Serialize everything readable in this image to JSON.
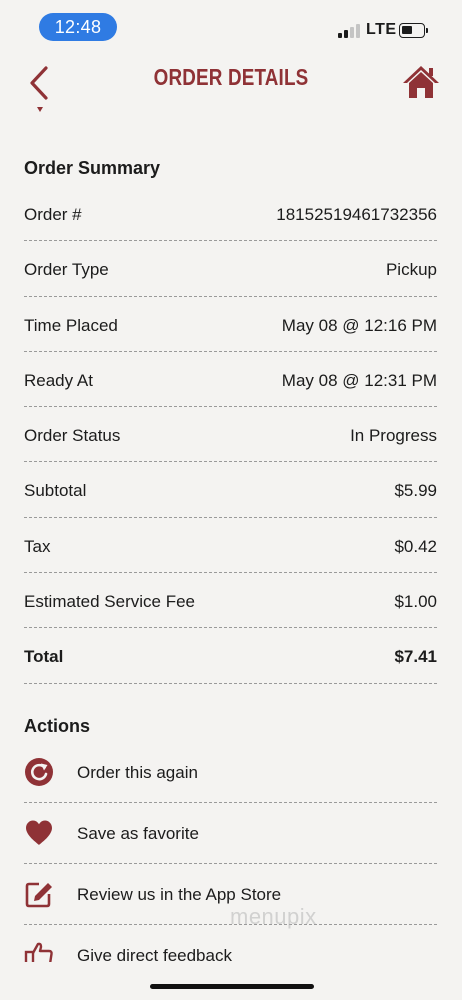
{
  "status_bar": {
    "time": "12:48",
    "network": "LTE"
  },
  "header": {
    "title": "ORDER DETAILS",
    "back_icon": "chevron-left-icon",
    "home_icon": "home-icon"
  },
  "colors": {
    "brand": "#8f3236",
    "time_pill": "#2f7be3",
    "background": "#f4f3f1"
  },
  "summary": {
    "title": "Order Summary",
    "rows": [
      {
        "label": "Order #",
        "value": "18152519461732356"
      },
      {
        "label": "Order Type",
        "value": "Pickup"
      },
      {
        "label": "Time Placed",
        "value": "May 08 @ 12:16 PM"
      },
      {
        "label": "Ready At",
        "value": "May 08 @ 12:31 PM"
      },
      {
        "label": "Order Status",
        "value": "In Progress"
      },
      {
        "label": "Subtotal",
        "value": "$5.99"
      },
      {
        "label": "Tax",
        "value": "$0.42"
      },
      {
        "label": "Estimated Service Fee",
        "value": "$1.00"
      },
      {
        "label": "Total",
        "value": "$7.41"
      }
    ]
  },
  "actions": {
    "title": "Actions",
    "items": [
      {
        "label": "Order this again",
        "icon": "reorder-icon"
      },
      {
        "label": "Save as favorite",
        "icon": "heart-icon"
      },
      {
        "label": "Review us in the App Store",
        "icon": "edit-icon"
      },
      {
        "label": "Give direct feedback",
        "icon": "thumbs-up-icon"
      }
    ]
  },
  "watermark": "menupix"
}
